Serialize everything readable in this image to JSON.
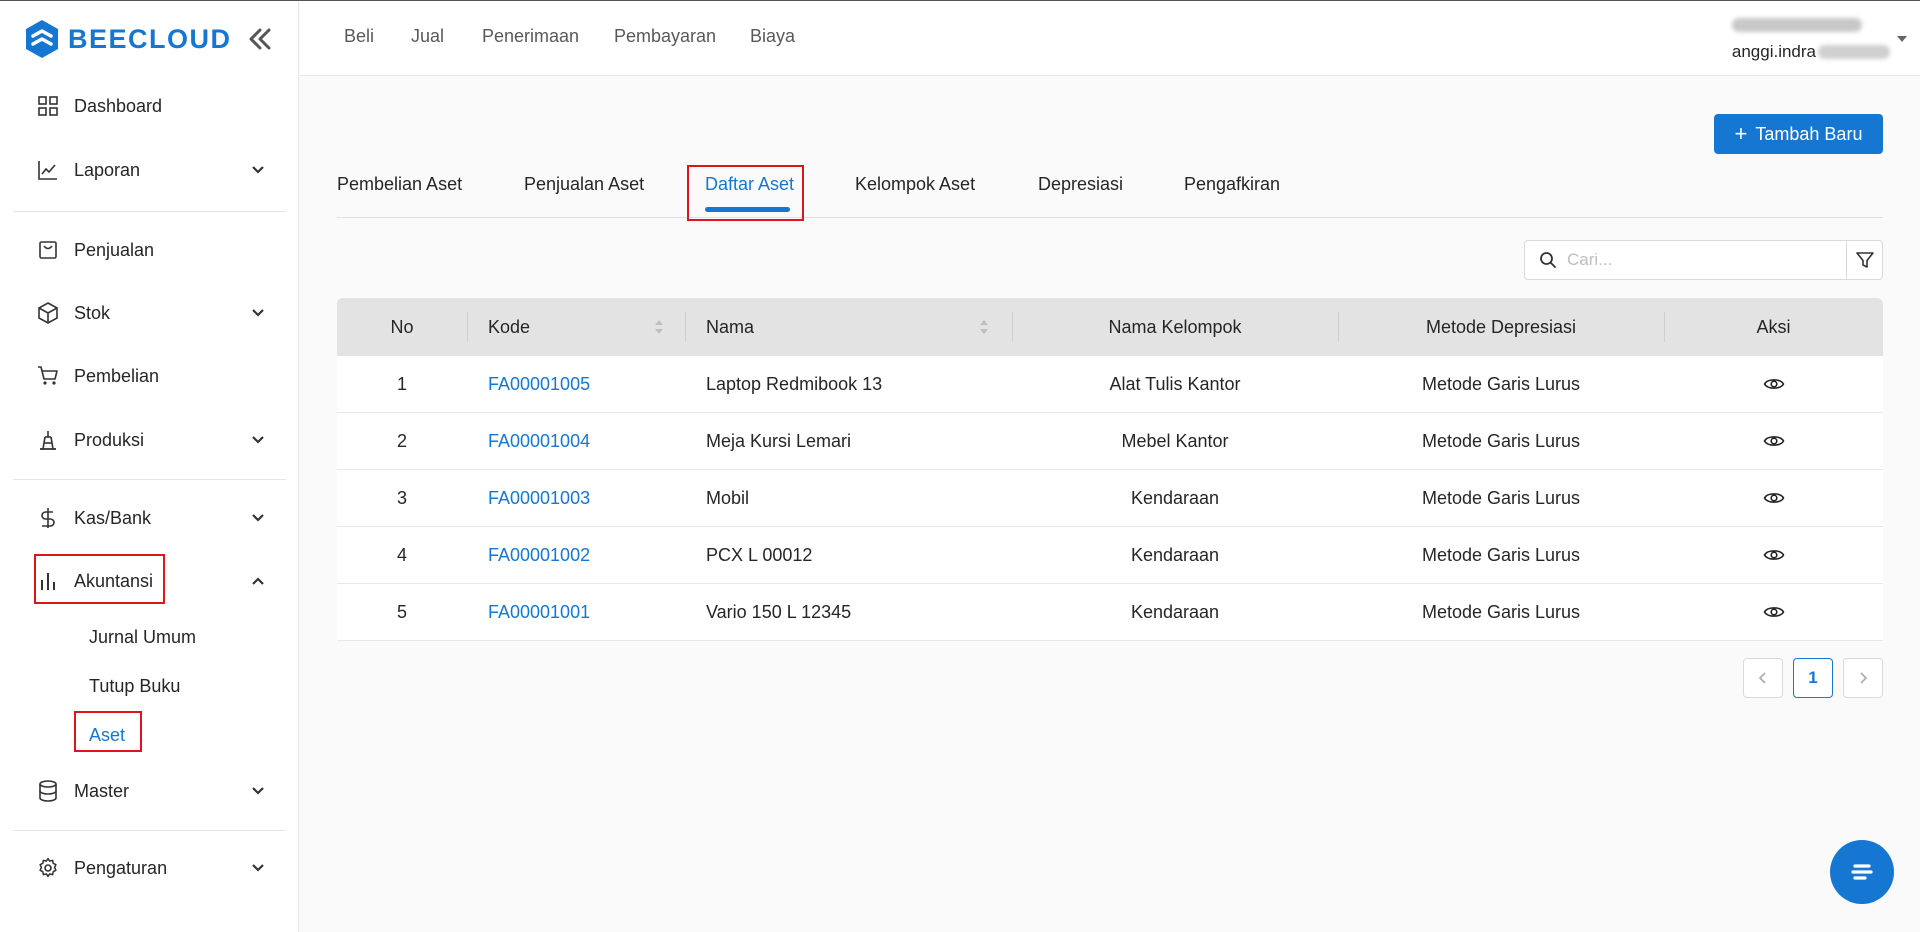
{
  "app": {
    "brand": "BEECLOUD",
    "brand_color": "#1677d2"
  },
  "sidebar": {
    "items": [
      {
        "label": "Dashboard",
        "icon": "dashboard-icon"
      },
      {
        "label": "Laporan",
        "icon": "chart-line-icon"
      },
      {
        "label": "Penjualan",
        "icon": "shopping-bag-icon"
      },
      {
        "label": "Stok",
        "icon": "box-icon"
      },
      {
        "label": "Pembelian",
        "icon": "cart-icon"
      },
      {
        "label": "Produksi",
        "icon": "factory-icon"
      },
      {
        "label": "Kas/Bank",
        "icon": "dollar-icon"
      },
      {
        "label": "Akuntansi",
        "icon": "bar-chart-icon"
      },
      {
        "label": "Master",
        "icon": "database-icon"
      },
      {
        "label": "Pengaturan",
        "icon": "gear-icon"
      }
    ],
    "akuntansi_sub": [
      "Jurnal Umum",
      "Tutup Buku",
      "Aset"
    ]
  },
  "topnav": {
    "items": [
      "Beli",
      "Jual",
      "Penerimaan",
      "Pembayaran",
      "Biaya"
    ]
  },
  "user": {
    "name_visible": "anggi.indra"
  },
  "main": {
    "add_button": "Tambah Baru",
    "tabs": [
      "Pembelian Aset",
      "Penjualan Aset",
      "Daftar Aset",
      "Kelompok Aset",
      "Depresiasi",
      "Pengafkiran"
    ],
    "active_tab": "Daftar Aset",
    "search_placeholder": "Cari...",
    "table": {
      "headers": [
        "No",
        "Kode",
        "Nama",
        "Nama Kelompok",
        "Metode Depresiasi",
        "Aksi"
      ],
      "rows": [
        {
          "no": "1",
          "kode": "FA00001005",
          "nama": "Laptop Redmibook 13",
          "kelompok": "Alat Tulis Kantor",
          "metode": "Metode Garis Lurus"
        },
        {
          "no": "2",
          "kode": "FA00001004",
          "nama": "Meja Kursi Lemari",
          "kelompok": "Mebel Kantor",
          "metode": "Metode Garis Lurus"
        },
        {
          "no": "3",
          "kode": "FA00001003",
          "nama": "Mobil",
          "kelompok": "Kendaraan",
          "metode": "Metode Garis Lurus"
        },
        {
          "no": "4",
          "kode": "FA00001002",
          "nama": "PCX L 00012",
          "kelompok": "Kendaraan",
          "metode": "Metode Garis Lurus"
        },
        {
          "no": "5",
          "kode": "FA00001001",
          "nama": "Vario 150 L 12345",
          "kelompok": "Kendaraan",
          "metode": "Metode Garis Lurus"
        }
      ]
    },
    "pagination": {
      "current_page": "1"
    }
  }
}
